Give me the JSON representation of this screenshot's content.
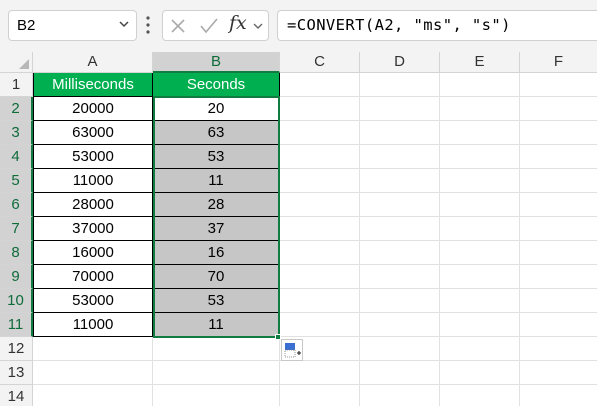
{
  "formula_bar": {
    "name_box": "B2",
    "fx_label": "fx",
    "formula": "=CONVERT(A2, \"ms\", \"s\")"
  },
  "icons": {
    "name_box_chevron": "chevron-down-icon",
    "more": "vertical-dots-icon",
    "cancel": "close-icon",
    "enter": "checkmark-icon",
    "fx_chevron": "chevron-down-icon",
    "quick_analysis": "quick-analysis-icon"
  },
  "colors": {
    "header_fill": "#00b050",
    "header_text": "#ffffff",
    "shaded_fill": "#c6c6c6",
    "selection_border": "#107c41"
  },
  "sheet": {
    "columns": [
      "A",
      "B",
      "C",
      "D",
      "E",
      "F"
    ],
    "rows": [
      "1",
      "2",
      "3",
      "4",
      "5",
      "6",
      "7",
      "8",
      "9",
      "10",
      "11",
      "12",
      "13",
      "14"
    ],
    "header": [
      "Milliseconds",
      "Seconds"
    ],
    "data": [
      [
        "20000",
        "20"
      ],
      [
        "63000",
        "63"
      ],
      [
        "53000",
        "53"
      ],
      [
        "11000",
        "11"
      ],
      [
        "28000",
        "28"
      ],
      [
        "37000",
        "37"
      ],
      [
        "16000",
        "16"
      ],
      [
        "70000",
        "70"
      ],
      [
        "53000",
        "53"
      ],
      [
        "11000",
        "11"
      ]
    ],
    "active_cell": "B2",
    "selected_range": "B2:B11"
  }
}
